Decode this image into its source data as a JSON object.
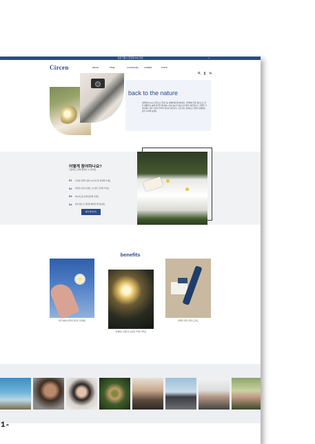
{
  "topbar": {
    "text": "지금 가입시 첫구매 20% 할인",
    "close": "×"
  },
  "brand": {
    "logo": "Circen",
    "accent": "#2b4a8a"
  },
  "nav": {
    "items": [
      "about",
      "shop",
      "community",
      "contact",
      "event"
    ],
    "active_index": 2
  },
  "nav_icons": [
    "search-icon",
    "user-icon",
    "cart-icon"
  ],
  "hero": {
    "title": "back to the nature",
    "text": "써클렌(Circen) 자연으로 돌아가는 캠페인에 참여하세요. 자연에서 얻은 영감으로 만든 제품들을 통해 환경을 생각하는 지속가능한 라이프스타일을 제안합니다. 자연을 가까이하는 작은 습관이 우리의 일상을 바꿉니다. 지금 바로 참여하고 자연과 함께하는 삶을 시작해 보세요."
  },
  "howto": {
    "title": "어떻게 참여하나요?",
    "subtitle": "간단하고 쉽게 참여할 수 있어요",
    "steps": [
      {
        "num": "01",
        "text": "가까운 자연을 찾아 나서 사진을 촬영해 주세요"
      },
      {
        "num": "02",
        "text": "촬영한 사진과 함께 느낀 점을 기록해 주세요"
      },
      {
        "num": "03",
        "text": "해시태그와 함께 공유해 주세요"
      },
      {
        "num": "04",
        "text": "참여 완료 후 써클렌 혜택을 받아보세요"
      }
    ],
    "button": "참여 하러가기"
  },
  "benefits": {
    "title": "benefits",
    "items": [
      {
        "caption": "자연 속에서 여유와 휴식을 경험해요"
      },
      {
        "caption": "함께하는 사람들과 소중한 추억을 쌓아요"
      },
      {
        "caption": "써클렌 특별 선물을 드려요"
      }
    ]
  },
  "gallery": {
    "count": 8
  },
  "page_number": "1-"
}
